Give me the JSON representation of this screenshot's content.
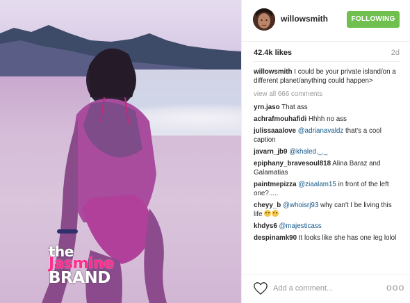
{
  "post": {
    "photo_watermark": {
      "line1": "the",
      "line2": "Jasmine",
      "line3": "BRAND"
    }
  },
  "header": {
    "username": "willowsmith",
    "follow_label": "FOLLOWING"
  },
  "meta": {
    "likes": "42.4k likes",
    "time_ago": "2d"
  },
  "caption": {
    "username": "willowsmith",
    "text": " I could be your private island/on a different planet/anything could happen>"
  },
  "view_all": "view all 666 comments",
  "comments": [
    {
      "user": "yrn.jaso",
      "text": " That ass"
    },
    {
      "user": "achrafmouhafidi",
      "text": " Hhhh no ass"
    },
    {
      "user": "julissaaalove",
      "mention": " @adrianavaldz",
      "text": " that's a cool caption"
    },
    {
      "user": "javarn_jb9",
      "mention": " @khaled._._",
      "text": ""
    },
    {
      "user": "epiphany_bravesoul818",
      "text": " Alina Baraz and Galamatias"
    },
    {
      "user": "paintmepizza",
      "mention": " @ziaalam15",
      "text": " in front of the left one?....."
    },
    {
      "user": "cheyy_b",
      "mention": " @whoisrj93",
      "text": " why can't I be living this life"
    },
    {
      "user": "khdys6",
      "mention": " @majesticass",
      "text": ""
    },
    {
      "user": "despinamk90",
      "text": " It looks like she has one leg lolol"
    }
  ],
  "footer": {
    "add_comment_placeholder": "Add a comment...",
    "more_label": "ooo"
  },
  "colors": {
    "follow_green": "#70c050",
    "mention_blue": "#125688",
    "watermark_pink": "#ff2d8c"
  }
}
